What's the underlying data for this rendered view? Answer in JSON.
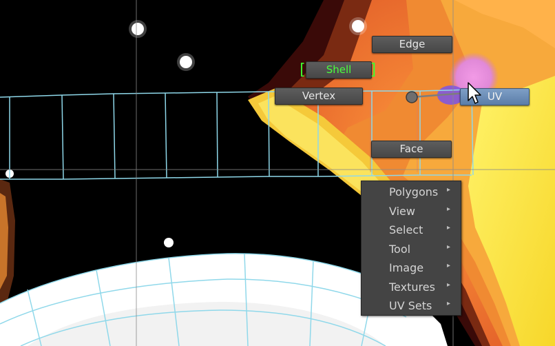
{
  "marking_menu": {
    "edge": "Edge",
    "shell": "Shell",
    "shell_bracket_left": "[",
    "shell_bracket_right": "]",
    "vertex": "Vertex",
    "uv": "UV",
    "face": "Face"
  },
  "context_menu": {
    "items": [
      {
        "label": "Polygons",
        "has_submenu": true
      },
      {
        "label": "View",
        "has_submenu": true
      },
      {
        "label": "Select",
        "has_submenu": true
      },
      {
        "label": "Tool",
        "has_submenu": true
      },
      {
        "label": "Image",
        "has_submenu": true
      },
      {
        "label": "Textures",
        "has_submenu": true
      },
      {
        "label": "UV Sets",
        "has_submenu": true
      }
    ],
    "submenu_arrow": "▸"
  },
  "colors": {
    "uv_wire": "#8fd8ea",
    "shell_text": "#4bff3c",
    "uv_highlight": "#6b8cb8",
    "menu_bg": "#444444"
  }
}
